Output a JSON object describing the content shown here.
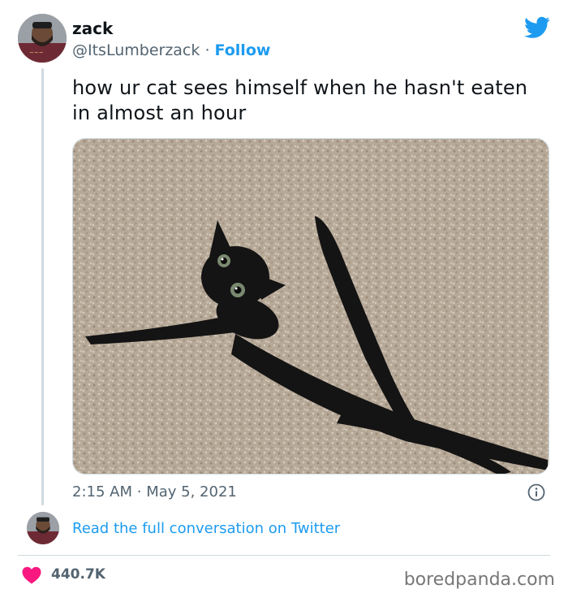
{
  "author": {
    "display_name": "zack",
    "handle": "@ItsLumberzack",
    "separator": "·",
    "follow_label": "Follow"
  },
  "tweet": {
    "text": "how ur cat sees himself when he hasn't eaten\nin almost an hour",
    "time": "2:15 AM",
    "date": "May 5, 2021",
    "meta_separator": "·"
  },
  "conversation": {
    "link_label": "Read the full conversation on Twitter"
  },
  "engagement": {
    "likes": "440.7K"
  },
  "watermark": "boredpanda.com",
  "colors": {
    "twitter_blue": "#1d9bf0",
    "like_pink": "#f91880",
    "muted": "#536471",
    "carpet": "#b6a898"
  },
  "icons": {
    "brand": "twitter-bird-icon",
    "info": "info-icon",
    "like": "heart-icon"
  }
}
